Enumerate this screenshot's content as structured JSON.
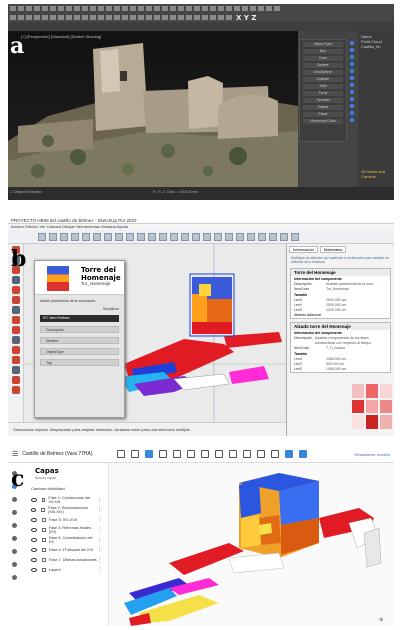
{
  "panel_a": {
    "label": "a",
    "viewport_caption": "[+] [Perspective] [Standard] [Default Shading]",
    "toolbar_axes": "X Y Z",
    "command_items": [
      "Object Type",
      "Box",
      "Cone",
      "Sphere",
      "GeoSphere",
      "Cylinder",
      "Tube",
      "Torus",
      "Pyramid",
      "Teapot",
      "Plane",
      "Name and Color"
    ],
    "scene_items": [
      "Name",
      "Point Cloud",
      "Castillo_fin"
    ],
    "scene_footer": "Art Mario and Caroline",
    "status_left": "1 Object Selected",
    "status_mid": "X: Y: Z: Grid = 1000,0mm"
  },
  "panel_b": {
    "label": "b",
    "window_title": "PROYECTO HBIM del castillo de Belmez - SketchUp Pro 2023",
    "menu": "Archivo Edición Ver Cámara Dibujar Herramientas Ventana Ayuda",
    "dialog": {
      "title": "Torre del Homenaje",
      "subtitle": "Tor_Homenaje",
      "hint": "Añadir parámetros de la renovación",
      "filter_label": "Simplificar",
      "selected": "IFC Item Refined",
      "fields": [
        "Descripción",
        "Nombre",
        "ObjectType",
        "Tag"
      ]
    },
    "right_tabs": [
      "Información",
      "Materiales"
    ],
    "right_note": "Modifique los atributos que aparecen a continuación para cambiar los atributos de la instancia.",
    "box1": {
      "header": "Torre del Homenaje",
      "section": "Información del componente",
      "rows": [
        [
          "Descripción",
          "Análisis paramental de la torre"
        ],
        [
          "ItemCode",
          "Tor_Homenaje"
        ]
      ],
      "section2": "Tamaño",
      "sizes": [
        [
          "LenX",
          "2600.000 cm"
        ],
        [
          "LenY",
          "2000.000 cm"
        ],
        [
          "LenZ",
          "1200.000 cm"
        ]
      ],
      "dynamic": "Atributo adicional"
    },
    "box2": {
      "header": "Alzado torre del Homenaje",
      "section": "Información del componente",
      "rows": [
        [
          "Descripción",
          "Alzados componentes de las fases constructivas con respecto al tiempo"
        ],
        [
          "ItemCode",
          "T_H_Alzado"
        ]
      ],
      "section2": "Tamaño",
      "sizes": [
        [
          "LenX",
          "1085.000 cm"
        ],
        [
          "LenY",
          "500.000 cm"
        ],
        [
          "LenZ",
          "1085.000 cm"
        ]
      ]
    },
    "status": "Seleccionar objetos. Mayúsculas para ampliar selección. Arrastrar ratón para una selección múltiple."
  },
  "panel_c": {
    "label": "c",
    "project": "Castillo de Belmez (Vara 77HA)",
    "export_label": "Restablecer modelo",
    "sidebar_title": "Capas",
    "search_placeholder": "Buscar capas",
    "visibility": "Cambiar visibilidad",
    "layers": [
      "Fase 1: Construcción del XII-XIII",
      "Fase 2: Reconstrucción (XIII-XIV)",
      "Fase 3: XIV-XVII",
      "Fase 4: Reformas finales (XV)",
      "Fase 5: Consolidación del XX",
      "Fase 6: 1ª década del XXI",
      "Fase 7: Últimas actuaciones",
      "Layer0"
    ]
  }
}
